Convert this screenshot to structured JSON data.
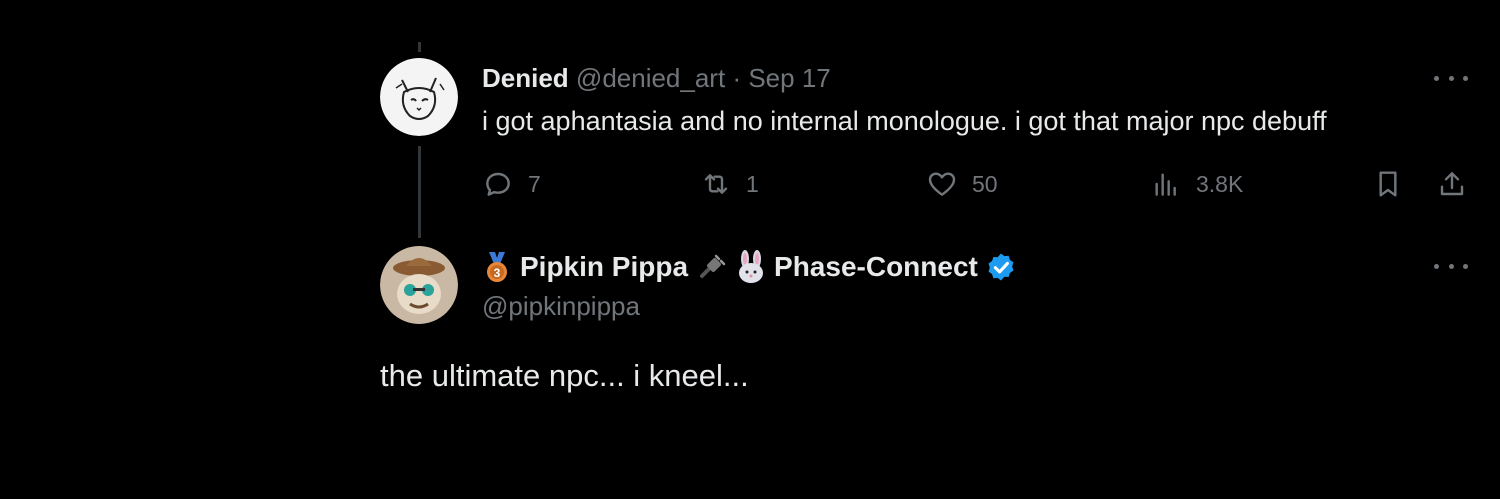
{
  "parent_tweet": {
    "display_name": "Denied",
    "handle": "@denied_art",
    "separator": "·",
    "date": "Sep 17",
    "text": "i got aphantasia and no internal monologue. i got that major npc debuff",
    "avatar_icon": "cat-sketch-avatar",
    "actions": {
      "replies": "7",
      "reposts": "1",
      "likes": "50",
      "views": "3.8K"
    }
  },
  "reply_tweet": {
    "display_name_prefix_icon": "third-place-medal-icon",
    "display_name_part1": "Pipkin Pippa",
    "display_name_mid_icons": [
      "plug-icon",
      "rabbit-icon"
    ],
    "display_name_part2": "Phase-Connect",
    "verified_badge": "verified-badge-icon",
    "handle": "@pipkinpippa",
    "text": "the ultimate npc... i kneel...",
    "avatar_icon": "character-avatar"
  },
  "colors": {
    "background": "#000000",
    "primary_text": "#e7e9ea",
    "secondary_text": "#71767b",
    "verified_blue": "#1d9bf0"
  }
}
